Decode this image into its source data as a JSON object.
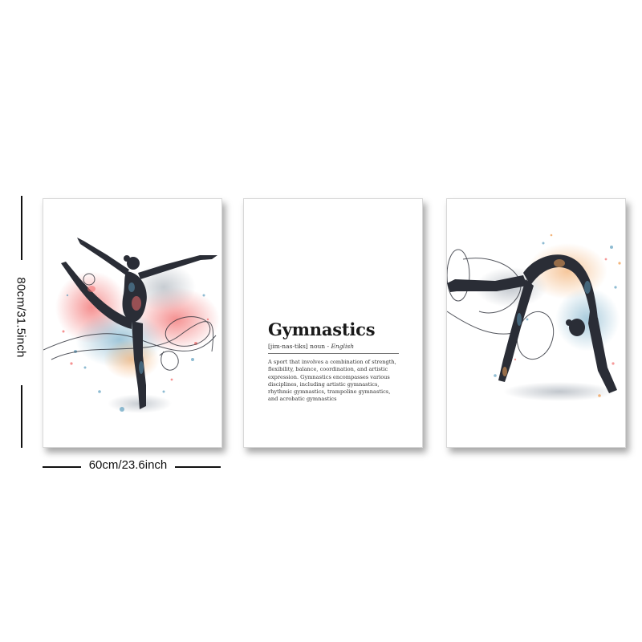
{
  "dimensions": {
    "height_label": "80cm/31.5inch",
    "width_label": "60cm/23.6inch"
  },
  "panels": {
    "left": {
      "image": "watercolor-gymnast-arabesque-ribbon"
    },
    "middle": {
      "title": "Gymnastics",
      "pronunciation": "[jim-nas-tiks]",
      "part_of_speech": "noun",
      "separator": " - ",
      "language": "English",
      "definition": "A sport that involves a combination of strength, flexibility, balance, coordination, and artistic expression. Gymnastics encompasses various disciplines, including artistic gymnastics, rhythmic gymnastics, trampoline gymnastics, and acrobatic gymnastics"
    },
    "right": {
      "image": "watercolor-gymnast-backbend-ribbon"
    }
  },
  "colors": {
    "figure": "#2a2d36",
    "splash_red": "#f26d6d",
    "splash_blue": "#5f9fbf",
    "splash_orange": "#f0a25a",
    "background": "#ffffff"
  }
}
